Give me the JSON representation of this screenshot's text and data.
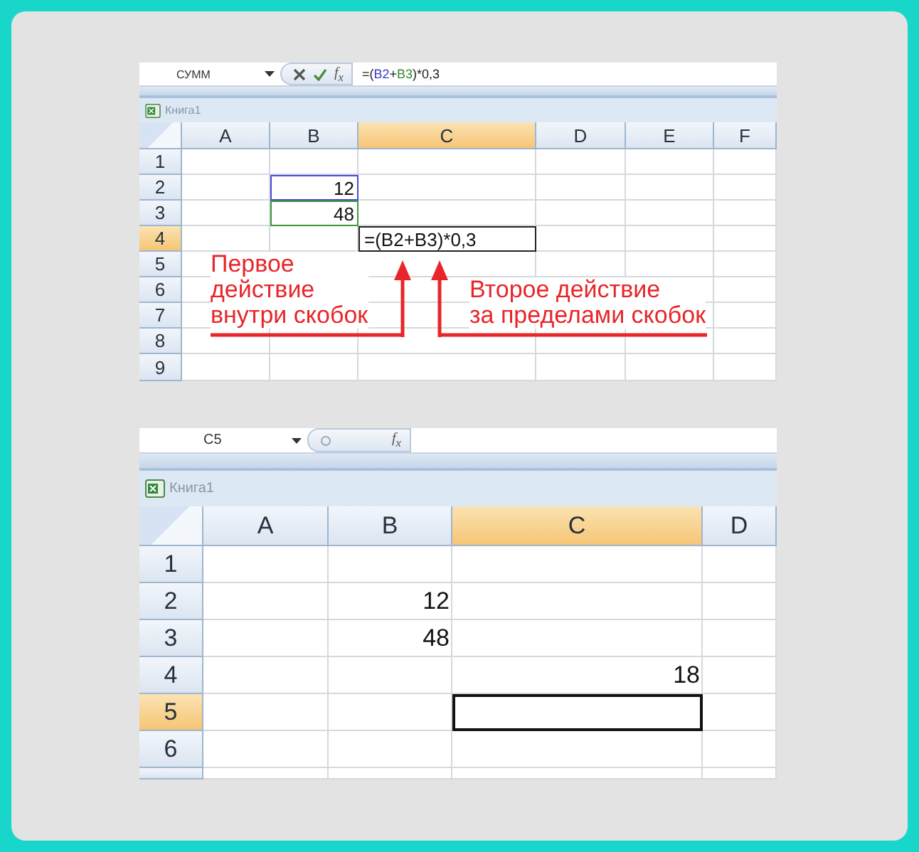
{
  "sheets": [
    {
      "name_box": "СУММ",
      "editing": true,
      "fx": "f$_{x}$",
      "formula_parts": [
        {
          "text": "=("
        },
        {
          "text": "B2",
          "color": "#3a3ac8"
        },
        {
          "text": "+"
        },
        {
          "text": "B3",
          "color": "#2e8b2e"
        },
        {
          "text": ")*0,3"
        }
      ],
      "workbook": "Книга1",
      "columns": [
        {
          "label": "A",
          "selected": false
        },
        {
          "label": "B",
          "selected": false
        },
        {
          "label": "C",
          "selected": true
        },
        {
          "label": "D",
          "selected": false
        },
        {
          "label": "E",
          "selected": false
        },
        {
          "label": "F",
          "selected": false
        }
      ],
      "rows": [
        {
          "label": "1",
          "selected": false,
          "cells": [
            null,
            null,
            null,
            null,
            null,
            null
          ]
        },
        {
          "label": "2",
          "selected": false,
          "cells": [
            null,
            {
              "text": "12",
              "color": "#4a4ad8"
            },
            null,
            null,
            null,
            null
          ]
        },
        {
          "label": "3",
          "selected": false,
          "cells": [
            null,
            {
              "text": "48",
              "color": "#3a9a3a"
            },
            null,
            null,
            null,
            null
          ]
        },
        {
          "label": "4",
          "selected": true,
          "cells": [
            null,
            null,
            {
              "text": "=(B2+B3)*0,3",
              "kind": "editing"
            },
            null,
            null,
            null
          ]
        },
        {
          "label": "5",
          "selected": false,
          "cells": [
            null,
            null,
            null,
            null,
            null,
            null
          ]
        },
        {
          "label": "6",
          "selected": false,
          "cells": [
            null,
            null,
            null,
            null,
            null,
            null
          ]
        },
        {
          "label": "7",
          "selected": false,
          "cells": [
            null,
            null,
            null,
            null,
            null,
            null
          ]
        },
        {
          "label": "8",
          "selected": false,
          "cells": [
            null,
            null,
            null,
            null,
            null,
            null
          ]
        },
        {
          "label": "9",
          "selected": false,
          "cells": [
            null,
            null,
            null,
            null,
            null,
            null
          ]
        }
      ],
      "annotations": [
        {
          "text": "Первое\nдействие\nвнутри скобок"
        },
        {
          "text": "Второе действие\nза пределами скобок"
        }
      ]
    },
    {
      "name_box": "C5",
      "editing": false,
      "fx": "f$_{x}$",
      "workbook": "Книга1",
      "columns": [
        {
          "label": "A",
          "selected": false
        },
        {
          "label": "B",
          "selected": false
        },
        {
          "label": "C",
          "selected": true
        },
        {
          "label": "D",
          "selected": false
        }
      ],
      "rows": [
        {
          "label": "1",
          "selected": false,
          "cells": [
            null,
            null,
            null,
            null
          ]
        },
        {
          "label": "2",
          "selected": false,
          "cells": [
            null,
            {
              "text": "12"
            },
            null,
            null
          ]
        },
        {
          "label": "3",
          "selected": false,
          "cells": [
            null,
            {
              "text": "48"
            },
            null,
            null
          ]
        },
        {
          "label": "4",
          "selected": false,
          "cells": [
            null,
            null,
            {
              "text": "18"
            },
            null
          ]
        },
        {
          "label": "5",
          "selected": true,
          "cells": [
            null,
            null,
            {
              "kind": "active"
            },
            null
          ]
        },
        {
          "label": "6",
          "selected": false,
          "cells": [
            null,
            null,
            null,
            null
          ]
        },
        {
          "selected": false,
          "cells": [
            null,
            null,
            null,
            null
          ]
        }
      ]
    }
  ]
}
